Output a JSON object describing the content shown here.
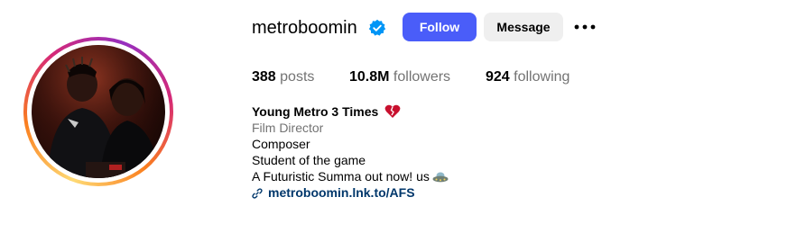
{
  "profile": {
    "username": "metroboomin",
    "verified_icon": "verified-badge-icon",
    "follow_label": "Follow",
    "message_label": "Message",
    "more_icon": "more-options-icon"
  },
  "stats": {
    "posts_count": "388",
    "posts_label": "posts",
    "followers_count": "10.8M",
    "followers_label": "followers",
    "following_count": "924",
    "following_label": "following"
  },
  "bio": {
    "name": "Young Metro 3 Times",
    "name_emoji": "broken-heart-icon",
    "category": "Film Director",
    "line1": "Composer",
    "line2": "Student of the game",
    "line3": "A Futuristic Summa out now! us",
    "line3_emoji": "flying-saucer-icon",
    "link": "metroboomin.lnk.to/AFS",
    "link_icon": "link-icon"
  },
  "colors": {
    "follow_button": "#4a5df9",
    "message_button": "#efefef",
    "verified_badge": "#0095f6",
    "link_text": "#00376b",
    "muted_text": "#737373"
  }
}
